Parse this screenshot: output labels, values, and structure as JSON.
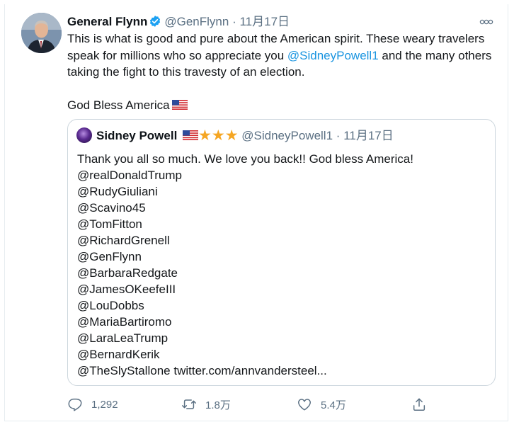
{
  "tweet": {
    "name": "General Flynn",
    "handle": "@GenFlynn",
    "separator": "·",
    "date": "11月17日",
    "more_icon": "more-icon",
    "text_part1": "This is what is good and pure about the American spirit. These weary travelers speak for millions who so appreciate you ",
    "mention": "@SidneyPowell1",
    "text_part2": " and the many others taking the fight to this travesty of an election.",
    "text_line2": "God Bless America"
  },
  "quote": {
    "name": "Sidney Powell",
    "stars": "★★★",
    "handle": "@SidneyPowell1",
    "separator": "·",
    "date": "11月17日",
    "first_line": "Thank you all so much. We love you back!! God bless America!",
    "mentions": [
      "@realDonaldTrump",
      "@RudyGiuliani",
      "@Scavino45",
      "@TomFitton",
      "@RichardGrenell",
      "@GenFlynn",
      "@BarbaraRedgate",
      "@JamesOKeefeIII",
      "@LouDobbs",
      "@MariaBartiromo",
      "@LaraLeaTrump",
      "@BernardKerik"
    ],
    "last_mention": "@TheSlyStallone",
    "link": "twitter.com/annvandersteel..."
  },
  "actions": {
    "reply_count": "1,292",
    "retweet_count": "1.8万",
    "like_count": "5.4万"
  },
  "colors": {
    "link": "#1b95e0",
    "secondary": "#5b7083",
    "verified": "#1da1f2",
    "star": "#f5a623"
  }
}
